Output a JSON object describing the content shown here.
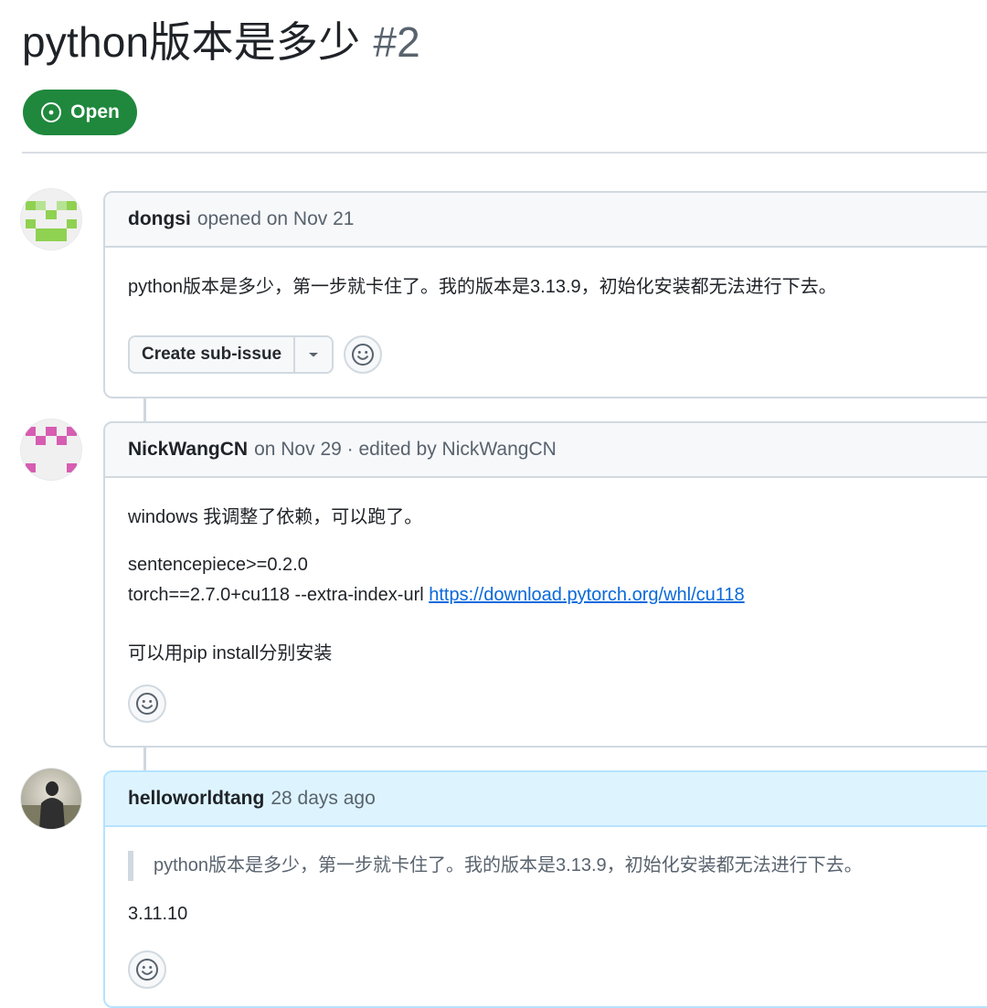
{
  "issue": {
    "title": "python版本是多少",
    "number": "#2",
    "state": "Open",
    "state_color": "#1f883d"
  },
  "comments": [
    {
      "author": "dongsi",
      "meta": "opened on Nov 21",
      "body": [
        "python版本是多少，第一步就卡住了。我的版本是3.13.9，初始化安装都无法进行下去。"
      ],
      "sub_issue_button": "Create sub-issue",
      "avatar_icon": "identicon-green"
    },
    {
      "author": "NickWangCN",
      "meta": "on Nov 29 · edited by NickWangCN",
      "body": [
        "windows 我调整了依赖，可以跑了。",
        "sentencepiece>=0.2.0",
        "torch==2.7.0+cu118 --extra-index-url ",
        "可以用pip install分别安装"
      ],
      "link": "https://download.pytorch.org/whl/cu118",
      "avatar_icon": "identicon-pink"
    },
    {
      "author": "helloworldtang",
      "meta": "28 days ago",
      "quote": "python版本是多少，第一步就卡住了。我的版本是3.13.9，初始化安装都无法进行下去。",
      "body": [
        "3.11.10"
      ],
      "avatar_icon": "photo-avatar",
      "highlight_color": "#ddf4ff"
    }
  ]
}
